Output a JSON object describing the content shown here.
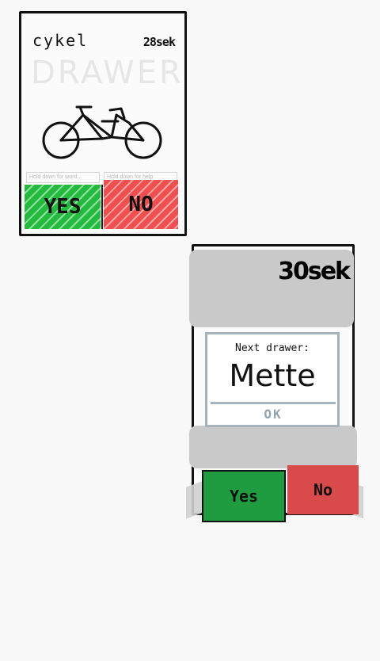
{
  "screen1": {
    "word": "cykel",
    "timer": "28sek",
    "role": "DRAWER",
    "hints": [
      "Hold down for word...",
      "Hold down for help"
    ],
    "yes_label": "YES",
    "no_label": "NO"
  },
  "screen2": {
    "timer": "30sek",
    "dialog": {
      "label": "Next drawer:",
      "name": "Mette",
      "ok_label": "OK"
    },
    "yes_label": "Yes",
    "no_label": "No"
  },
  "colors": {
    "yes": "#1f9c3f",
    "no": "#d94a4a",
    "dialog_border": "#a7b3bc",
    "overlay": "#c9c9c9"
  }
}
